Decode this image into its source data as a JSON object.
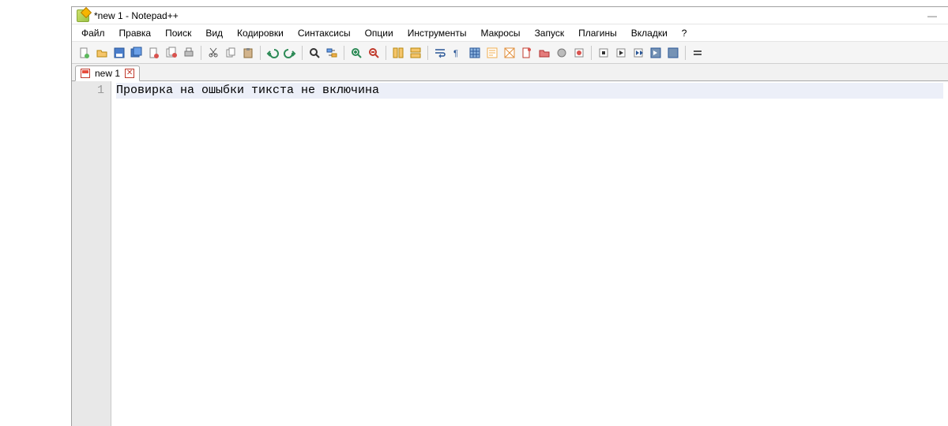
{
  "title": "*new 1 - Notepad++",
  "menubar": [
    "Файл",
    "Правка",
    "Поиск",
    "Вид",
    "Кодировки",
    "Синтаксисы",
    "Опции",
    "Инструменты",
    "Макросы",
    "Запуск",
    "Плагины",
    "Вкладки",
    "?"
  ],
  "toolbar_icons": [
    "new-file",
    "open-file",
    "save-file",
    "save-all",
    "close-file",
    "close-all",
    "print",
    "|",
    "cut",
    "copy",
    "paste",
    "|",
    "undo",
    "redo",
    "|",
    "find",
    "replace",
    "|",
    "zoom-in",
    "zoom-out",
    "|",
    "sync-v",
    "sync-h",
    "|",
    "word-wrap",
    "show-all-chars",
    "indent-guide",
    "language",
    "folder-doc",
    "doc-map",
    "function-list",
    "folder",
    "monitor",
    "|",
    "record-macro",
    "stop-macro",
    "play-macro",
    "play-multiple",
    "save-macro",
    "|",
    "toggle"
  ],
  "tabs": [
    {
      "label": "new 1",
      "modified": true
    }
  ],
  "editor": {
    "lines": [
      {
        "num": "1",
        "text": "Провирка на ошыбки тикста не включина"
      }
    ]
  },
  "window_controls": {
    "minimize": "—"
  }
}
